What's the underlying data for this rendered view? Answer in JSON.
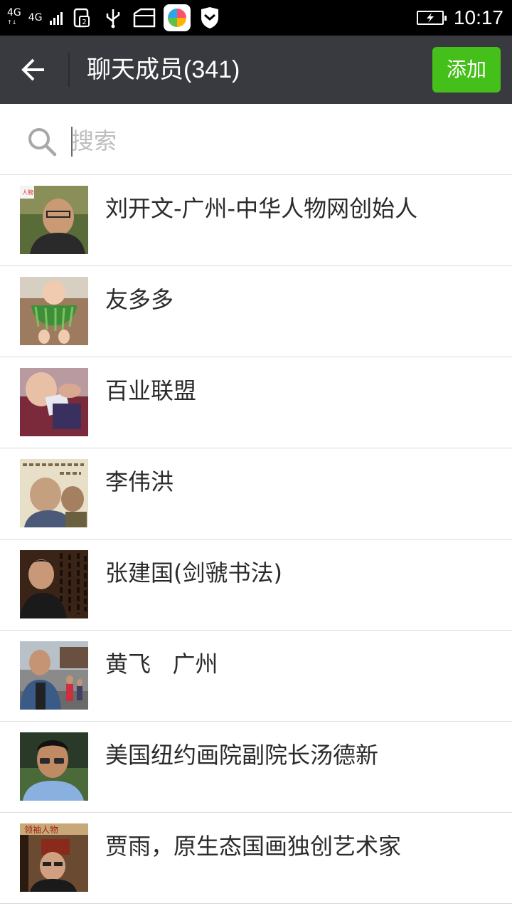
{
  "status_bar": {
    "network1": "4G",
    "network2": "4G",
    "time": "10:17",
    "notification_count": "2"
  },
  "title_bar": {
    "title": "聊天成员(341)",
    "add_label": "添加"
  },
  "search": {
    "placeholder": "搜索"
  },
  "members": [
    {
      "name": "刘开文-广州-中华人物网创始人"
    },
    {
      "name": "友多多"
    },
    {
      "name": "百业联盟"
    },
    {
      "name": "李伟洪"
    },
    {
      "name": "张建国(剑虢书法)"
    },
    {
      "name": "黄飞   广州"
    },
    {
      "name": "美国纽约画院副院长汤德新"
    },
    {
      "name": "贾雨，原生态国画独创艺术家"
    }
  ],
  "colors": {
    "titlebar": "#393a3f",
    "accent": "#45c01a",
    "statusbar": "#000000"
  }
}
